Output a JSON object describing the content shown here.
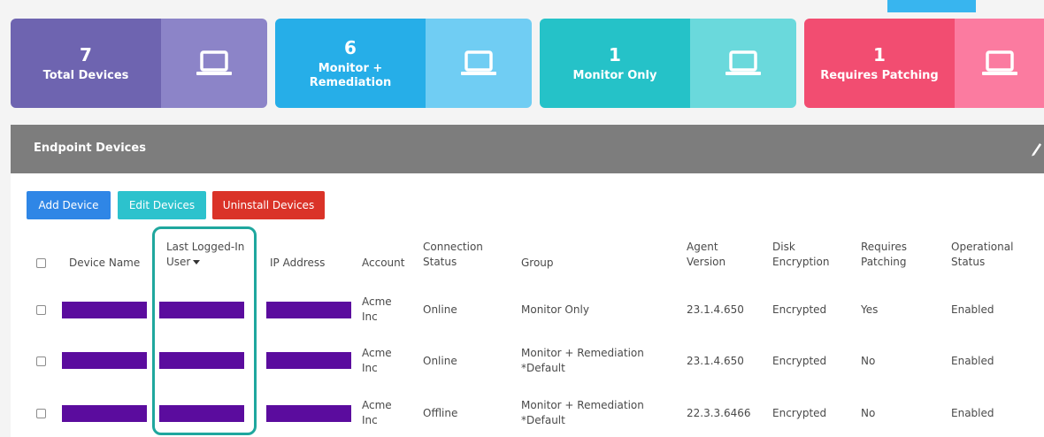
{
  "colors": {
    "card_total_left": "#6e64b0",
    "card_total_right": "#8c84c8",
    "card_monrem_left": "#26aee8",
    "card_monrem_right": "#70cdf3",
    "card_monitor_left": "#25c2c8",
    "card_monitor_right": "#6ad9dc",
    "card_patch_left": "#f24d71",
    "card_patch_right": "#fb7ba0",
    "add_button": "#2f86e6",
    "edit_button": "#2cc2cd",
    "uninstall_button": "#da3328",
    "panel_header": "#7d7d7d",
    "highlight_box": "#1fa79e",
    "redaction": "#5b0c9e"
  },
  "cards": [
    {
      "number": "7",
      "label": "Total Devices",
      "icon": "laptop-icon"
    },
    {
      "number": "6",
      "label_line1": "Monitor +",
      "label_line2": "Remediation",
      "icon": "laptop-icon"
    },
    {
      "number": "1",
      "label": "Monitor Only",
      "icon": "laptop-icon"
    },
    {
      "number": "1",
      "label": "Requires Patching",
      "icon": "laptop-icon"
    }
  ],
  "panel": {
    "title": "Endpoint Devices",
    "edit_icon": "pencil-icon"
  },
  "buttons": {
    "add": "Add Device",
    "edit": "Edit Devices",
    "uninstall": "Uninstall Devices"
  },
  "table": {
    "headers": {
      "device_name": "Device Name",
      "last_user_1": "Last Logged-In",
      "last_user_2": "User",
      "ip": "IP Address",
      "account": "Account",
      "connection_1": "Connection",
      "connection_2": "Status",
      "group": "Group",
      "agent_1": "Agent",
      "agent_2": "Version",
      "disk_1": "Disk",
      "disk_2": "Encryption",
      "patch_1": "Requires",
      "patch_2": "Patching",
      "op_1": "Operational",
      "op_2": "Status"
    },
    "rows": [
      {
        "account_1": "Acme",
        "account_2": "Inc",
        "connection": "Online",
        "group_1": "Monitor Only",
        "group_2": "",
        "agent": "23.1.4.650",
        "disk": "Encrypted",
        "patching": "Yes",
        "op_status": "Enabled"
      },
      {
        "account_1": "Acme",
        "account_2": "Inc",
        "connection": "Online",
        "group_1": "Monitor + Remediation",
        "group_2": "*Default",
        "agent": "23.1.4.650",
        "disk": "Encrypted",
        "patching": "No",
        "op_status": "Enabled"
      },
      {
        "account_1": "Acme",
        "account_2": "Inc",
        "connection": "Offline",
        "group_1": "Monitor + Remediation",
        "group_2": "*Default",
        "agent": "22.3.3.6466",
        "disk": "Encrypted",
        "patching": "No",
        "op_status": "Enabled"
      }
    ]
  }
}
